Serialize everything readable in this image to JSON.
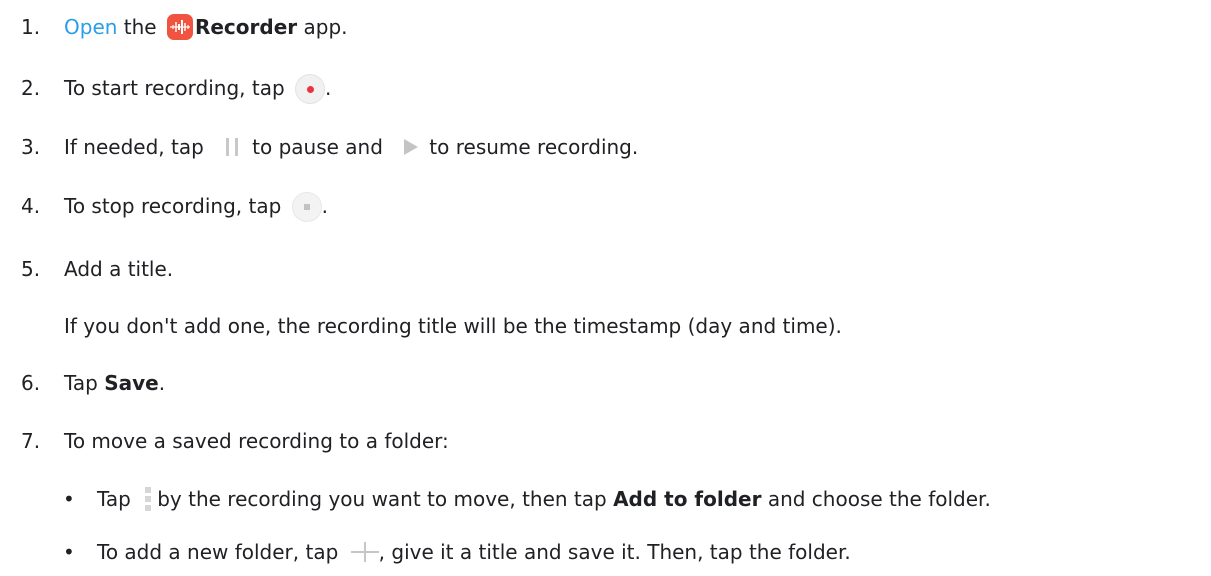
{
  "steps": [
    {
      "number": "1.",
      "link": "Open",
      "the": " the ",
      "app_name": "Recorder",
      "after": " app."
    },
    {
      "number": "2.",
      "before": "To start recording, tap ",
      "after": "."
    },
    {
      "number": "3.",
      "before": "If needed, tap ",
      "middle": "to pause and ",
      "after": "to resume recording."
    },
    {
      "number": "4.",
      "before": "To stop recording, tap ",
      "after": "."
    },
    {
      "number": "5.",
      "text": "Add a title.",
      "note": "If you don't add one, the recording title will be the timestamp (day and time)."
    },
    {
      "number": "6.",
      "before": "Tap ",
      "bold": "Save",
      "after": "."
    },
    {
      "number": "7.",
      "text": "To move a saved recording to a folder:"
    }
  ],
  "bullets": [
    {
      "symbol": "•",
      "before": "Tap ",
      "middle": "by the recording you want to move, then tap ",
      "bold": "Add to folder",
      "after": " and choose the folder."
    },
    {
      "symbol": "•",
      "before": "To add a new folder, tap ",
      "after": ", give it a title and save it. Then, tap the folder."
    }
  ],
  "icons": {
    "recorder_app": "recorder-app-icon",
    "record": "record-button-icon",
    "pause": "pause-icon",
    "play": "play-icon",
    "stop": "stop-button-icon",
    "more": "more-options-icon",
    "add": "plus-icon"
  },
  "colors": {
    "link": "#2a9ee8",
    "recorder_app_bg": "#f0533f",
    "record_dot": "#e8353b",
    "text": "#202124"
  }
}
